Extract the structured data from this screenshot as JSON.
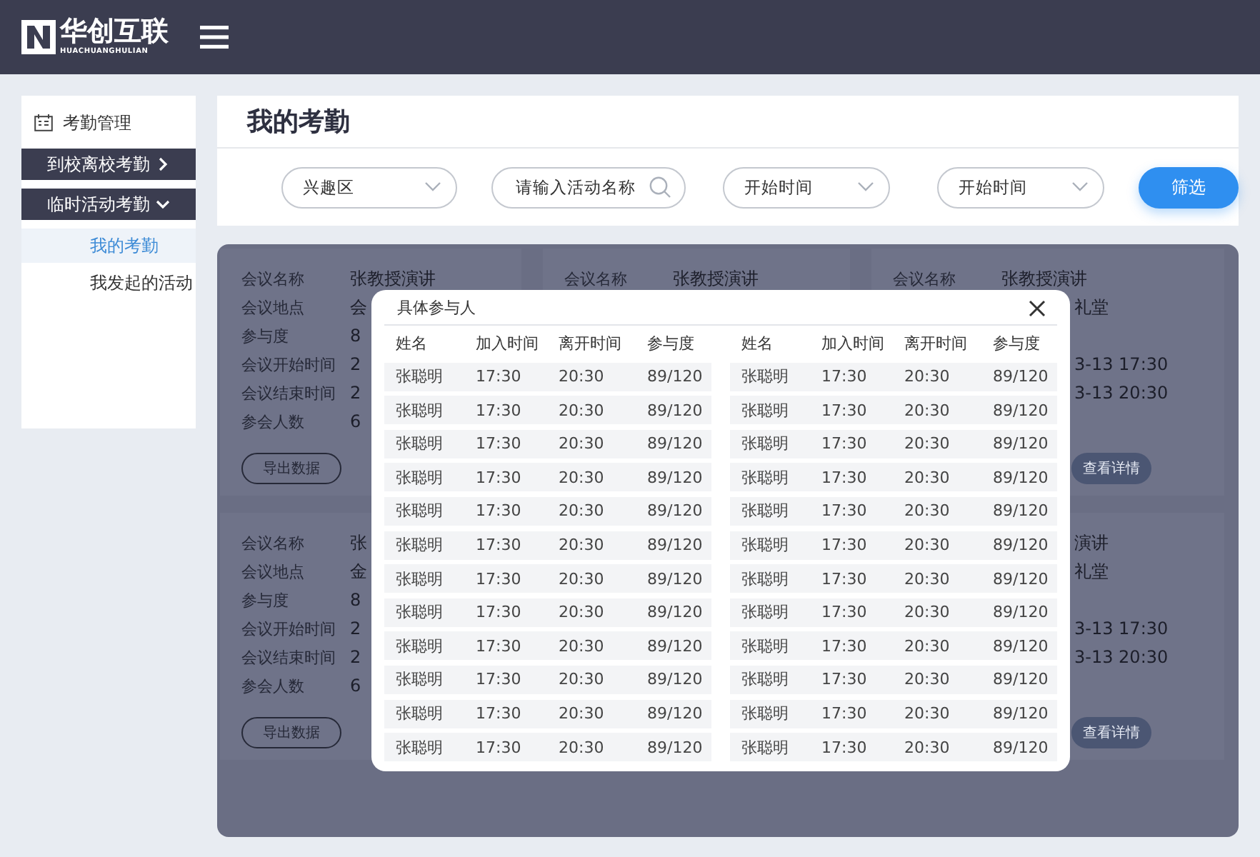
{
  "header": {
    "logo_text": "华创互联",
    "logo_subtext": "HUACHUANGHULIAN"
  },
  "sidebar": {
    "title": "考勤管理",
    "groups": [
      {
        "label": "到校离校考勤",
        "expanded": false
      },
      {
        "label": "临时活动考勤",
        "expanded": true,
        "children": [
          {
            "label": "我的考勤",
            "selected": true
          },
          {
            "label": "我发起的活动",
            "selected": false
          }
        ]
      }
    ]
  },
  "page_title": "我的考勤",
  "filters": [
    {
      "kind": "select",
      "value": "兴趣区"
    },
    {
      "kind": "search",
      "placeholder": "请输入活动名称"
    },
    {
      "kind": "select",
      "value": "开始时间"
    },
    {
      "kind": "select",
      "value": "开始时间"
    }
  ],
  "filter_button": "筛选",
  "cards": [
    {
      "fields": [
        {
          "kind": "full",
          "label": "会议名称",
          "value": "张教授演讲"
        },
        {
          "kind": "full",
          "label": "会议地点",
          "value": "会"
        },
        {
          "kind": "full",
          "label": "参与度",
          "value": "8"
        },
        {
          "kind": "full",
          "label": "会议开始时间",
          "value": "2"
        },
        {
          "kind": "full",
          "label": "会议结束时间",
          "value": "2"
        },
        {
          "kind": "full",
          "label": "参会人数",
          "value": "6"
        }
      ],
      "button": {
        "kind": "outline",
        "label": "导出数据"
      }
    },
    {
      "fields": [
        {
          "kind": "full",
          "label": "会议名称",
          "value": "张教授演讲"
        }
      ]
    },
    {
      "fields": [
        {
          "kind": "full",
          "label": "会议名称",
          "value": "张教授演讲"
        },
        {
          "kind": "tail",
          "value": "礼堂"
        },
        {
          "kind": "hidden"
        },
        {
          "kind": "tail",
          "value": "3-13  17:30"
        },
        {
          "kind": "tail",
          "value": "3-13  20:30"
        },
        {
          "kind": "hidden"
        }
      ],
      "button": {
        "kind": "filled",
        "label": "查看详情"
      }
    },
    {
      "fields": [
        {
          "kind": "full",
          "label": "会议名称",
          "value": "张"
        },
        {
          "kind": "full",
          "label": "会议地点",
          "value": "金"
        },
        {
          "kind": "full",
          "label": "参与度",
          "value": "8"
        },
        {
          "kind": "full",
          "label": "会议开始时间",
          "value": "2"
        },
        {
          "kind": "full",
          "label": "会议结束时间",
          "value": "2"
        },
        {
          "kind": "full",
          "label": "参会人数",
          "value": "6"
        }
      ],
      "button": {
        "kind": "outline",
        "label": "导出数据"
      }
    },
    {
      "fields": [
        {
          "kind": "tail",
          "value": "演讲"
        },
        {
          "kind": "tail",
          "value": "礼堂"
        },
        {
          "kind": "hidden"
        },
        {
          "kind": "tail",
          "value": "3-13  17:30"
        },
        {
          "kind": "tail",
          "value": "3-13  20:30"
        },
        {
          "kind": "hidden"
        }
      ],
      "button": {
        "kind": "filled",
        "label": "查看详情"
      }
    }
  ],
  "modal": {
    "title": "具体参与人",
    "tables": [
      {
        "columns": [
          "姓名",
          "加入时间",
          "离开时间",
          "参与度"
        ],
        "rows": [
          [
            "张聪明",
            "17:30",
            "20:30",
            "89/120"
          ],
          [
            "张聪明",
            "17:30",
            "20:30",
            "89/120"
          ],
          [
            "张聪明",
            "17:30",
            "20:30",
            "89/120"
          ],
          [
            "张聪明",
            "17:30",
            "20:30",
            "89/120"
          ],
          [
            "张聪明",
            "17:30",
            "20:30",
            "89/120"
          ],
          [
            "张聪明",
            "17:30",
            "20:30",
            "89/120"
          ],
          [
            "张聪明",
            "17:30",
            "20:30",
            "89/120"
          ],
          [
            "张聪明",
            "17:30",
            "20:30",
            "89/120"
          ],
          [
            "张聪明",
            "17:30",
            "20:30",
            "89/120"
          ],
          [
            "张聪明",
            "17:30",
            "20:30",
            "89/120"
          ],
          [
            "张聪明",
            "17:30",
            "20:30",
            "89/120"
          ],
          [
            "张聪明",
            "17:30",
            "20:30",
            "89/120"
          ]
        ]
      },
      {
        "columns": [
          "姓名",
          "加入时间",
          "离开时间",
          "参与度"
        ],
        "rows": [
          [
            "张聪明",
            "17:30",
            "20:30",
            "89/120"
          ],
          [
            "张聪明",
            "17:30",
            "20:30",
            "89/120"
          ],
          [
            "张聪明",
            "17:30",
            "20:30",
            "89/120"
          ],
          [
            "张聪明",
            "17:30",
            "20:30",
            "89/120"
          ],
          [
            "张聪明",
            "17:30",
            "20:30",
            "89/120"
          ],
          [
            "张聪明",
            "17:30",
            "20:30",
            "89/120"
          ],
          [
            "张聪明",
            "17:30",
            "20:30",
            "89/120"
          ],
          [
            "张聪明",
            "17:30",
            "20:30",
            "89/120"
          ],
          [
            "张聪明",
            "17:30",
            "20:30",
            "89/120"
          ],
          [
            "张聪明",
            "17:30",
            "20:30",
            "89/120"
          ],
          [
            "张聪明",
            "17:30",
            "20:30",
            "89/120"
          ],
          [
            "张聪明",
            "17:30",
            "20:30",
            "89/120"
          ]
        ]
      }
    ]
  }
}
